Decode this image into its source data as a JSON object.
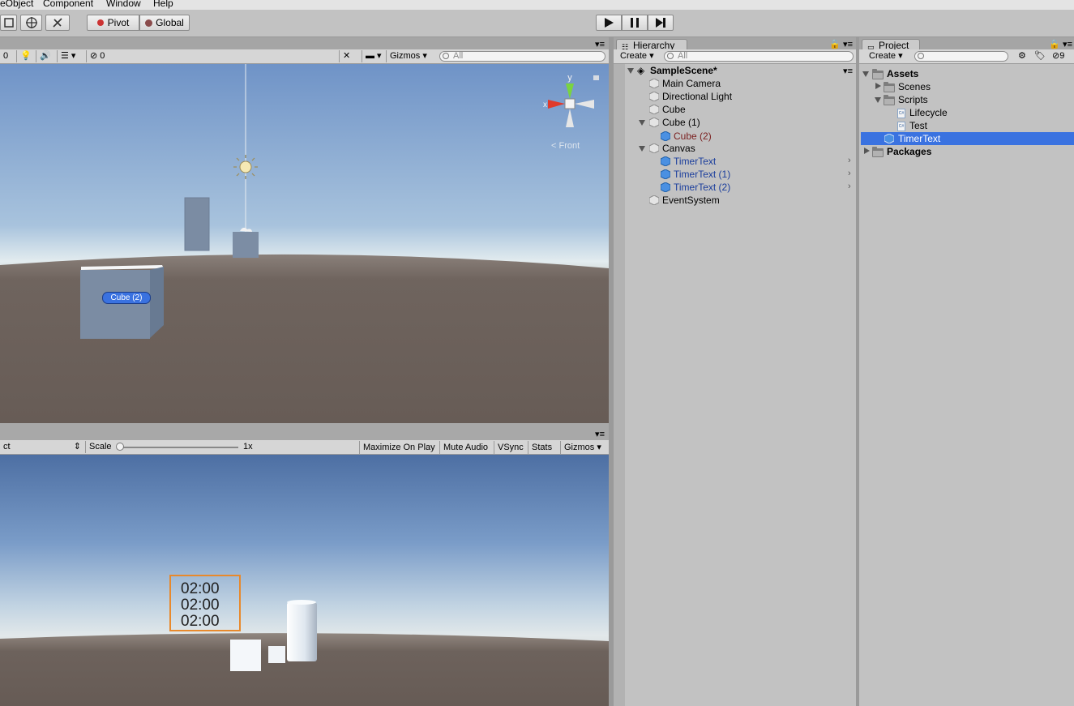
{
  "menu": {
    "items": [
      "eObject",
      "Component",
      "Window",
      "Help"
    ]
  },
  "toolbar": {
    "pivot_label": "Pivot",
    "global_label": "Global"
  },
  "scene_view": {
    "lighting_count": "0",
    "gizmos_label": "Gizmos",
    "search_placeholder": "All",
    "gizmo_axis_label": "y",
    "gizmo_x_label": "x",
    "view_label": "Front",
    "selected_object_label": "Cube (2)"
  },
  "game_view": {
    "aspect_label": "ct",
    "scale_label": "Scale",
    "scale_value": "1x",
    "maximize_label": "Maximize On Play",
    "mute_label": "Mute Audio",
    "vsync_label": "VSync",
    "stats_label": "Stats",
    "gizmos_label": "Gizmos",
    "timer_lines": [
      "02:00",
      "02:00",
      "02:00"
    ]
  },
  "hierarchy": {
    "tab_label": "Hierarchy",
    "create_label": "Create",
    "search_placeholder": "All",
    "scene_name": "SampleScene*",
    "items": [
      {
        "label": "Main Camera",
        "prefab": false
      },
      {
        "label": "Directional Light",
        "prefab": false
      },
      {
        "label": "Cube",
        "prefab": false
      },
      {
        "label": "Cube (1)",
        "prefab": false
      },
      {
        "label": "Cube (2)",
        "prefab": true
      },
      {
        "label": "Canvas",
        "prefab": false
      },
      {
        "label": "TimerText",
        "prefab": true
      },
      {
        "label": "TimerText (1)",
        "prefab": true
      },
      {
        "label": "TimerText (2)",
        "prefab": true
      },
      {
        "label": "EventSystem",
        "prefab": false
      }
    ]
  },
  "project": {
    "tab_label": "Project",
    "create_label": "Create",
    "hidden_count": "9",
    "items": [
      {
        "label": "Assets"
      },
      {
        "label": "Scenes"
      },
      {
        "label": "Scripts"
      },
      {
        "label": "Lifecycle"
      },
      {
        "label": "Test"
      },
      {
        "label": "TimerText"
      },
      {
        "label": "Packages"
      }
    ]
  },
  "colors": {
    "selection": "#3a72e0",
    "prefab_text": "#1a3d9c",
    "timer_border": "#e8892c",
    "sky_top": "#4d6fa3",
    "ground": "#6a5e58"
  }
}
